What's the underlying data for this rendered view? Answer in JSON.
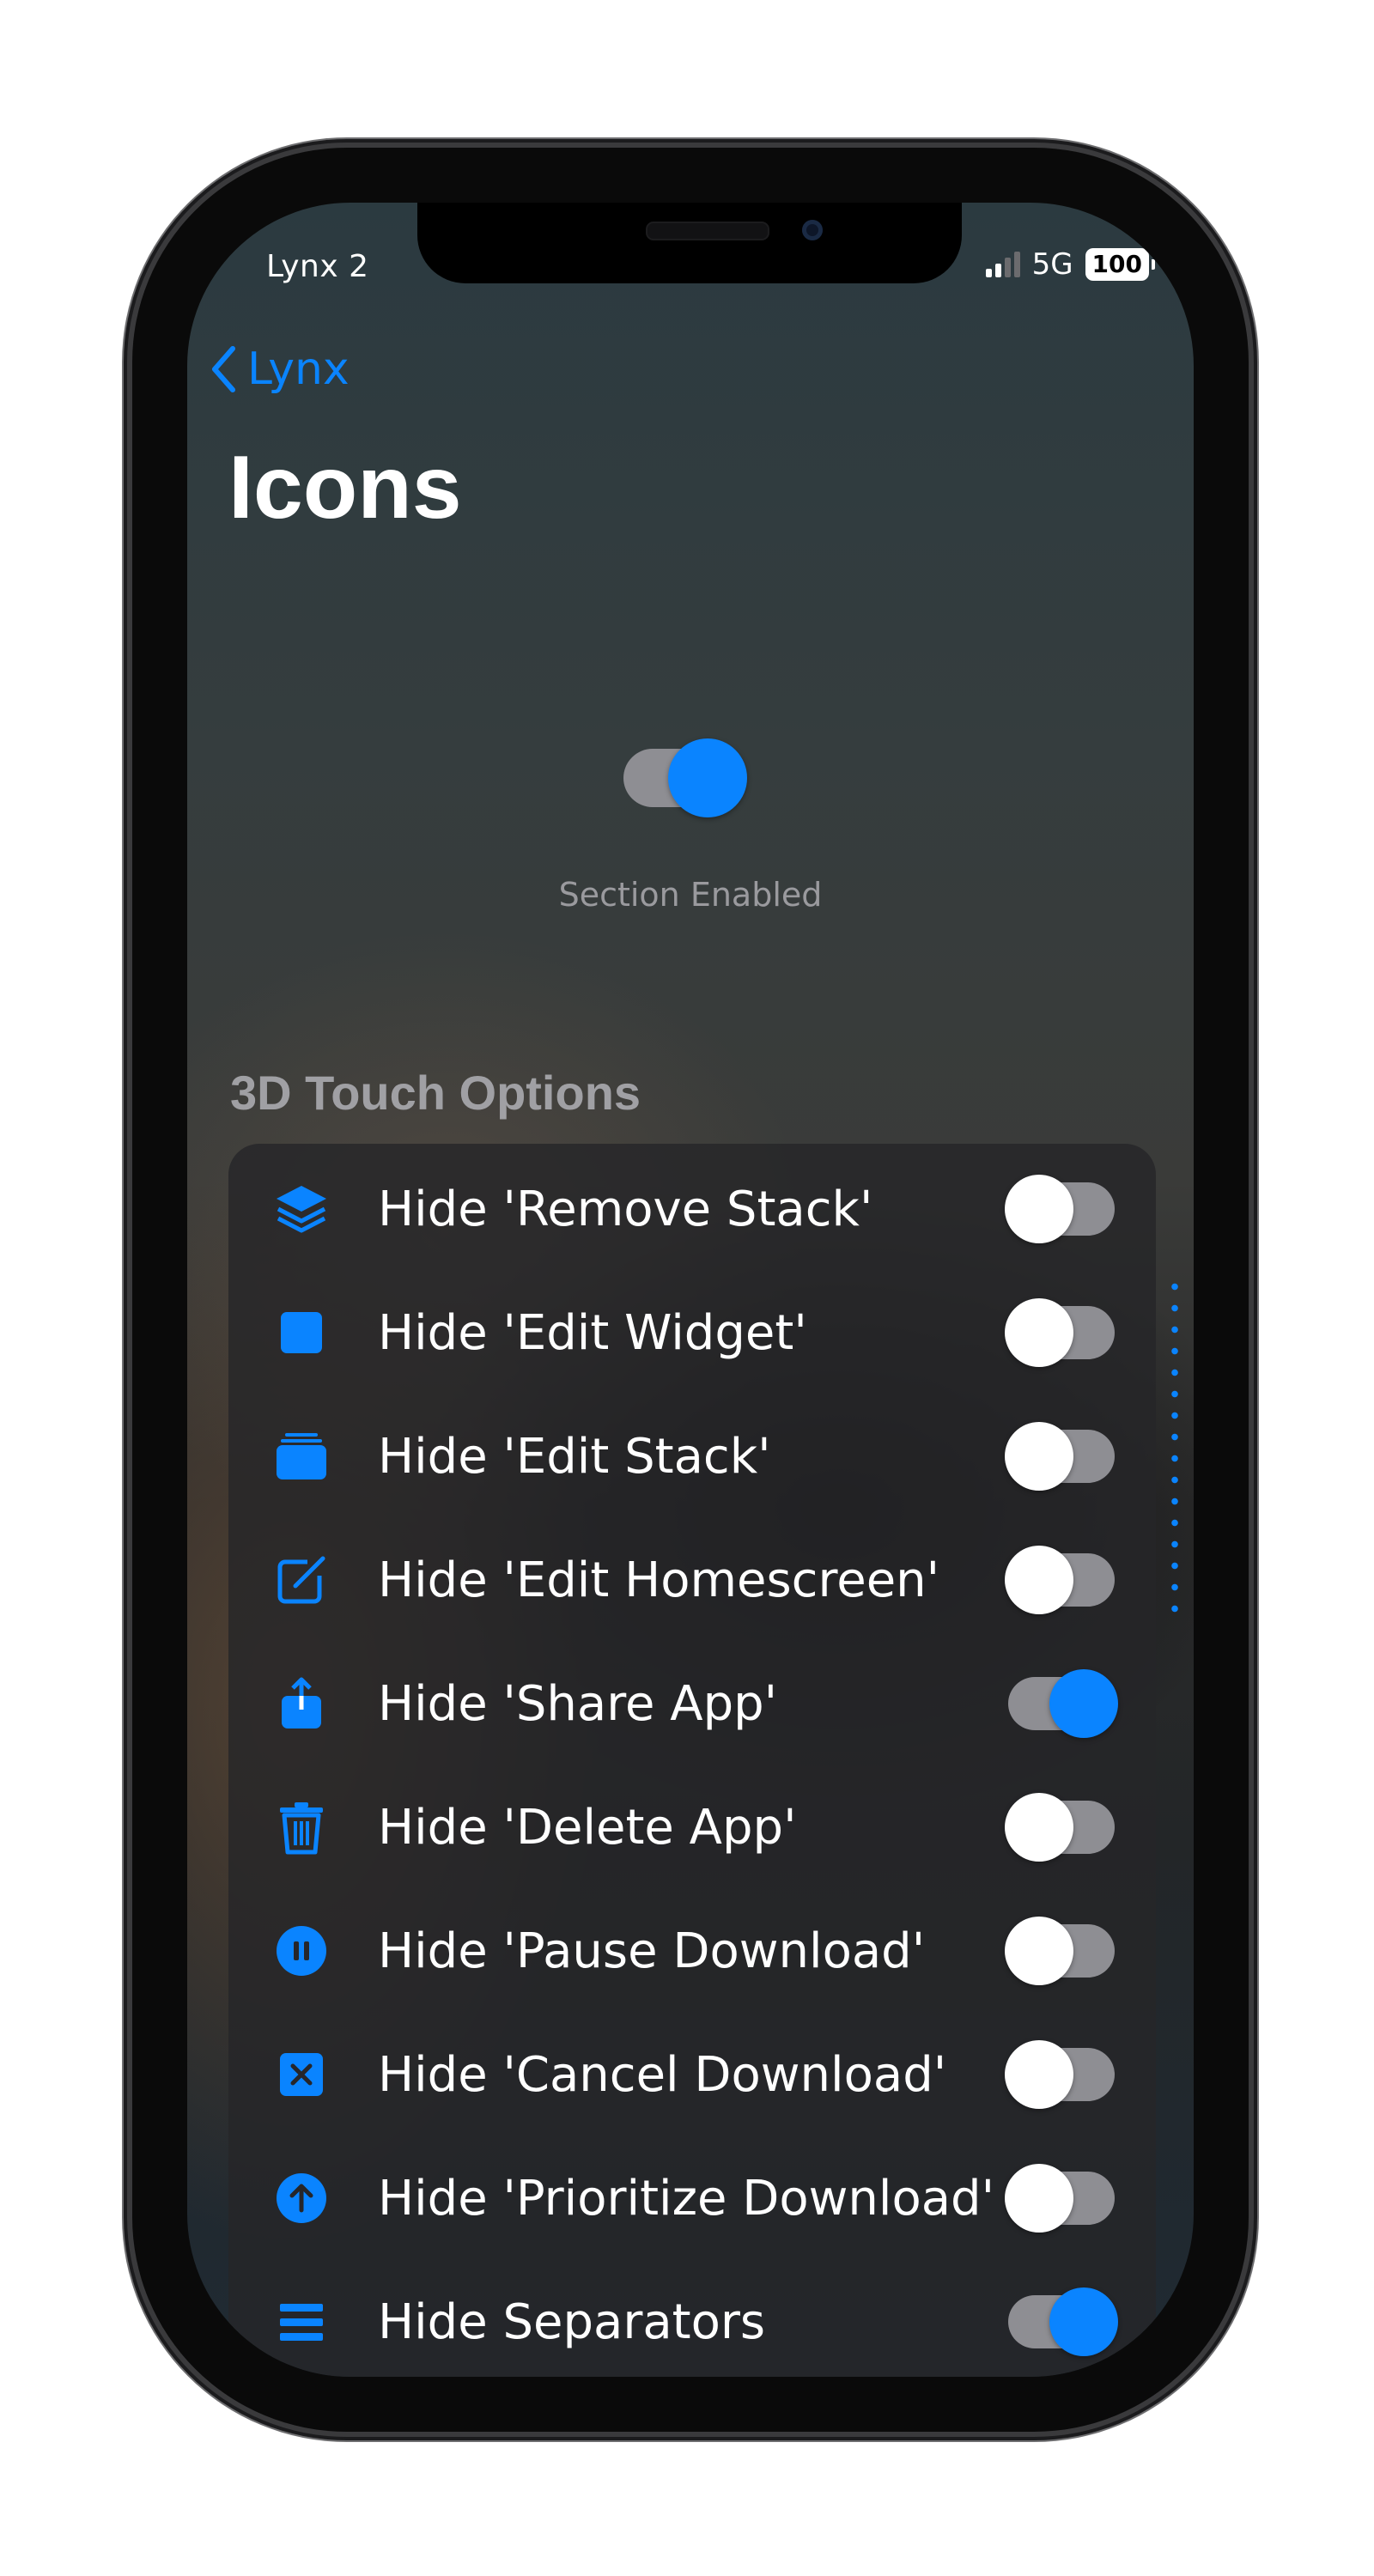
{
  "status_bar": {
    "carrier_label": "Lynx 2",
    "network": "5G",
    "battery": "100"
  },
  "nav": {
    "back_label": "Lynx",
    "title": "Icons"
  },
  "section": {
    "enabled": true,
    "label": "Section Enabled"
  },
  "group": {
    "header": "3D Touch Options",
    "rows": [
      {
        "icon": "stack-layers-icon",
        "label": "Hide 'Remove Stack'",
        "enabled": false
      },
      {
        "icon": "square-icon",
        "label": "Hide 'Edit Widget'",
        "enabled": false
      },
      {
        "icon": "stacked-cards-icon",
        "label": "Hide 'Edit Stack'",
        "enabled": false
      },
      {
        "icon": "square-pencil-icon",
        "label": "Hide 'Edit Homescreen'",
        "enabled": false
      },
      {
        "icon": "share-icon",
        "label": "Hide 'Share App'",
        "enabled": true
      },
      {
        "icon": "trash-icon",
        "label": "Hide 'Delete App'",
        "enabled": false
      },
      {
        "icon": "pause-circle-icon",
        "label": "Hide 'Pause Download'",
        "enabled": false
      },
      {
        "icon": "xmark-square-icon",
        "label": "Hide 'Cancel Download'",
        "enabled": false
      },
      {
        "icon": "arrow-up-circle-icon",
        "label": "Hide 'Prioritize Download'",
        "enabled": false
      },
      {
        "icon": "separators-icon",
        "label": "Hide Separators",
        "enabled": true
      }
    ]
  },
  "colors": {
    "accent": "#0a84ff",
    "toggle_track": "#8e8e93",
    "list_background": "#262628"
  }
}
